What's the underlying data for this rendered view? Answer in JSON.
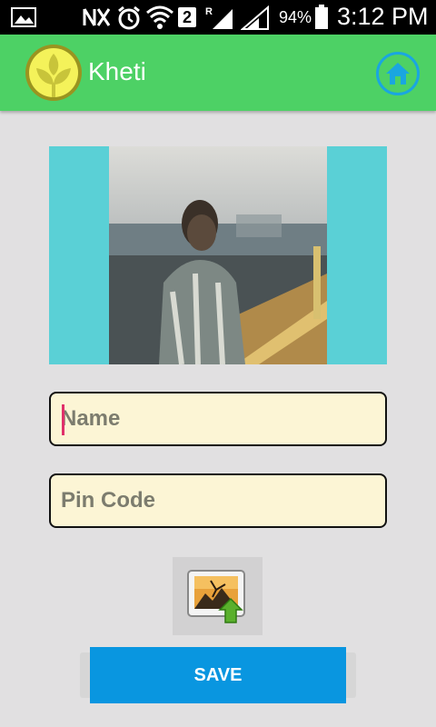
{
  "status_bar": {
    "battery_percent": "94%",
    "time": "3:12 PM",
    "sim_slot": "2",
    "roaming_indicator": "R",
    "icons": [
      "image-icon",
      "nfc-icon",
      "alarm-icon",
      "wifi-icon",
      "sim-2-icon",
      "signal-icon",
      "signal-icon",
      "battery-icon"
    ]
  },
  "action_bar": {
    "title": "Kheti",
    "logo_icon": "leaf-logo-icon",
    "home_icon": "home-icon",
    "color": "#4dd165"
  },
  "form": {
    "name_placeholder": "Name",
    "pin_placeholder": "Pin Code",
    "upload_icon": "image-upload-icon"
  },
  "save": {
    "label": "SAVE",
    "color": "#0996e0"
  }
}
